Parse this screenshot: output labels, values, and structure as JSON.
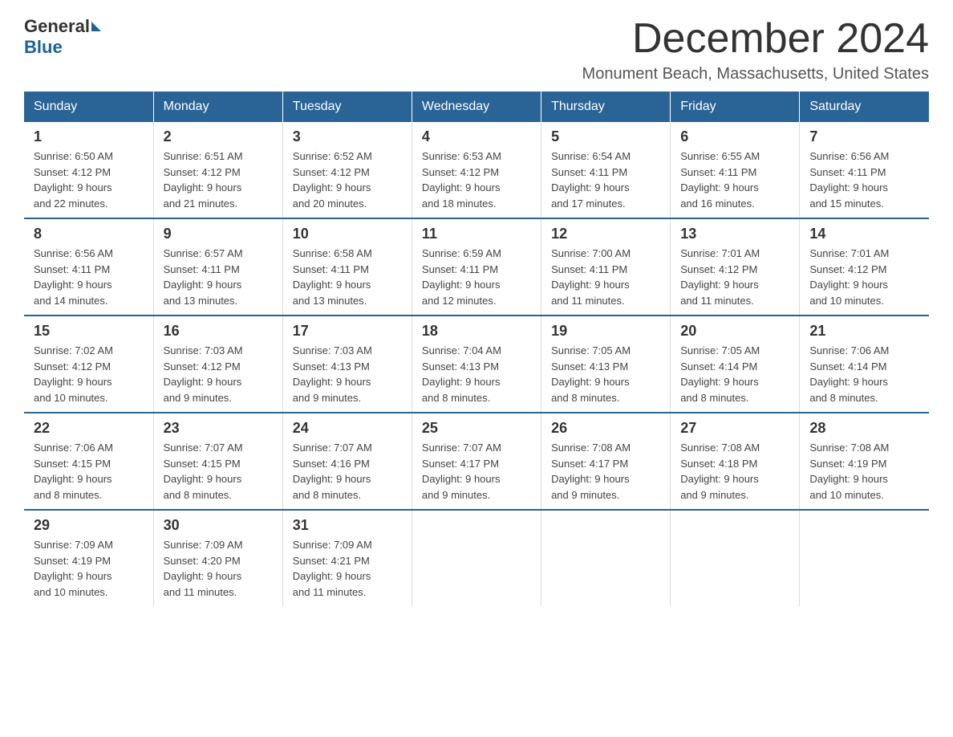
{
  "logo": {
    "general": "General",
    "blue": "Blue"
  },
  "title": "December 2024",
  "subtitle": "Monument Beach, Massachusetts, United States",
  "days_of_week": [
    "Sunday",
    "Monday",
    "Tuesday",
    "Wednesday",
    "Thursday",
    "Friday",
    "Saturday"
  ],
  "weeks": [
    [
      {
        "day": "1",
        "sunrise": "6:50 AM",
        "sunset": "4:12 PM",
        "daylight": "9 hours and 22 minutes."
      },
      {
        "day": "2",
        "sunrise": "6:51 AM",
        "sunset": "4:12 PM",
        "daylight": "9 hours and 21 minutes."
      },
      {
        "day": "3",
        "sunrise": "6:52 AM",
        "sunset": "4:12 PM",
        "daylight": "9 hours and 20 minutes."
      },
      {
        "day": "4",
        "sunrise": "6:53 AM",
        "sunset": "4:12 PM",
        "daylight": "9 hours and 18 minutes."
      },
      {
        "day": "5",
        "sunrise": "6:54 AM",
        "sunset": "4:11 PM",
        "daylight": "9 hours and 17 minutes."
      },
      {
        "day": "6",
        "sunrise": "6:55 AM",
        "sunset": "4:11 PM",
        "daylight": "9 hours and 16 minutes."
      },
      {
        "day": "7",
        "sunrise": "6:56 AM",
        "sunset": "4:11 PM",
        "daylight": "9 hours and 15 minutes."
      }
    ],
    [
      {
        "day": "8",
        "sunrise": "6:56 AM",
        "sunset": "4:11 PM",
        "daylight": "9 hours and 14 minutes."
      },
      {
        "day": "9",
        "sunrise": "6:57 AM",
        "sunset": "4:11 PM",
        "daylight": "9 hours and 13 minutes."
      },
      {
        "day": "10",
        "sunrise": "6:58 AM",
        "sunset": "4:11 PM",
        "daylight": "9 hours and 13 minutes."
      },
      {
        "day": "11",
        "sunrise": "6:59 AM",
        "sunset": "4:11 PM",
        "daylight": "9 hours and 12 minutes."
      },
      {
        "day": "12",
        "sunrise": "7:00 AM",
        "sunset": "4:11 PM",
        "daylight": "9 hours and 11 minutes."
      },
      {
        "day": "13",
        "sunrise": "7:01 AM",
        "sunset": "4:12 PM",
        "daylight": "9 hours and 11 minutes."
      },
      {
        "day": "14",
        "sunrise": "7:01 AM",
        "sunset": "4:12 PM",
        "daylight": "9 hours and 10 minutes."
      }
    ],
    [
      {
        "day": "15",
        "sunrise": "7:02 AM",
        "sunset": "4:12 PM",
        "daylight": "9 hours and 10 minutes."
      },
      {
        "day": "16",
        "sunrise": "7:03 AM",
        "sunset": "4:12 PM",
        "daylight": "9 hours and 9 minutes."
      },
      {
        "day": "17",
        "sunrise": "7:03 AM",
        "sunset": "4:13 PM",
        "daylight": "9 hours and 9 minutes."
      },
      {
        "day": "18",
        "sunrise": "7:04 AM",
        "sunset": "4:13 PM",
        "daylight": "9 hours and 8 minutes."
      },
      {
        "day": "19",
        "sunrise": "7:05 AM",
        "sunset": "4:13 PM",
        "daylight": "9 hours and 8 minutes."
      },
      {
        "day": "20",
        "sunrise": "7:05 AM",
        "sunset": "4:14 PM",
        "daylight": "9 hours and 8 minutes."
      },
      {
        "day": "21",
        "sunrise": "7:06 AM",
        "sunset": "4:14 PM",
        "daylight": "9 hours and 8 minutes."
      }
    ],
    [
      {
        "day": "22",
        "sunrise": "7:06 AM",
        "sunset": "4:15 PM",
        "daylight": "9 hours and 8 minutes."
      },
      {
        "day": "23",
        "sunrise": "7:07 AM",
        "sunset": "4:15 PM",
        "daylight": "9 hours and 8 minutes."
      },
      {
        "day": "24",
        "sunrise": "7:07 AM",
        "sunset": "4:16 PM",
        "daylight": "9 hours and 8 minutes."
      },
      {
        "day": "25",
        "sunrise": "7:07 AM",
        "sunset": "4:17 PM",
        "daylight": "9 hours and 9 minutes."
      },
      {
        "day": "26",
        "sunrise": "7:08 AM",
        "sunset": "4:17 PM",
        "daylight": "9 hours and 9 minutes."
      },
      {
        "day": "27",
        "sunrise": "7:08 AM",
        "sunset": "4:18 PM",
        "daylight": "9 hours and 9 minutes."
      },
      {
        "day": "28",
        "sunrise": "7:08 AM",
        "sunset": "4:19 PM",
        "daylight": "9 hours and 10 minutes."
      }
    ],
    [
      {
        "day": "29",
        "sunrise": "7:09 AM",
        "sunset": "4:19 PM",
        "daylight": "9 hours and 10 minutes."
      },
      {
        "day": "30",
        "sunrise": "7:09 AM",
        "sunset": "4:20 PM",
        "daylight": "9 hours and 11 minutes."
      },
      {
        "day": "31",
        "sunrise": "7:09 AM",
        "sunset": "4:21 PM",
        "daylight": "9 hours and 11 minutes."
      },
      null,
      null,
      null,
      null
    ]
  ]
}
